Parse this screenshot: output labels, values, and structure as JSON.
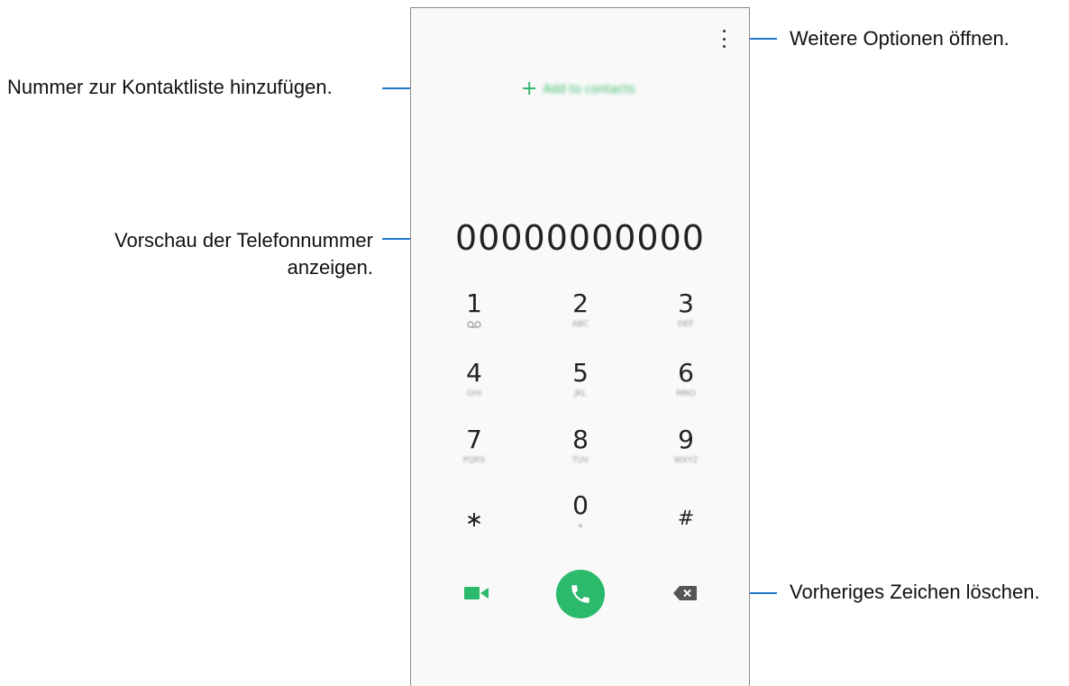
{
  "callouts": {
    "more_options": "Weitere Optionen öffnen.",
    "add_contact": "Nummer zur Kontaktliste hinzufügen.",
    "preview_line1": "Vorschau der Telefonnummer",
    "preview_line2": "anzeigen.",
    "delete_char": "Vorheriges Zeichen löschen."
  },
  "phone": {
    "add_contacts_label": "Add to contacts",
    "add_icon": "plus-icon",
    "number_display": "00000000000",
    "keypad": [
      {
        "digit": "1",
        "letters": ""
      },
      {
        "digit": "2",
        "letters": "ABC"
      },
      {
        "digit": "3",
        "letters": "DEF"
      },
      {
        "digit": "4",
        "letters": "GHI"
      },
      {
        "digit": "5",
        "letters": "JKL"
      },
      {
        "digit": "6",
        "letters": "MNO"
      },
      {
        "digit": "7",
        "letters": "PQRS"
      },
      {
        "digit": "8",
        "letters": "TUV"
      },
      {
        "digit": "9",
        "letters": "WXYZ"
      },
      {
        "digit": "∗",
        "letters": ""
      },
      {
        "digit": "0",
        "letters": "+"
      },
      {
        "digit": "#",
        "letters": ""
      }
    ],
    "accent_color": "#2bb96b"
  }
}
